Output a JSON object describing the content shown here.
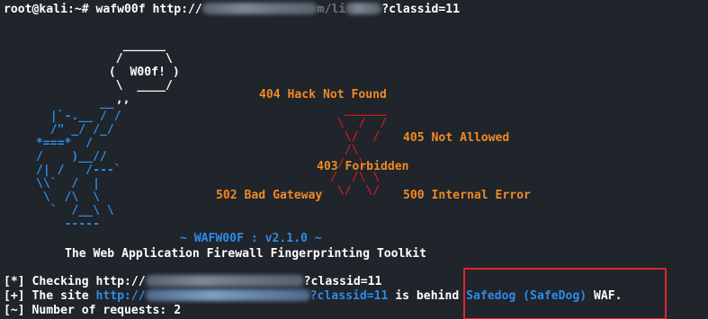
{
  "terminal": {
    "prompt": "root@kali:~# ",
    "command_start": "wafw00f http://",
    "command_end": "?classid=11"
  },
  "dog_art": {
    "hex_lines": [
      "   ______",
      "  /      \\",
      " (  W00f! )",
      "  \\  ____/",
      "  ,,"
    ],
    "dog_lines": [
      "         __",
      "  |`-.__ / /",
      "  /\" _/ /_/",
      "*===*  /",
      "/    )__//",
      "/| /   /---`",
      "\\\\`  /  |",
      " \\  /\\  \\",
      "  `  /__\\ \\",
      "    -----"
    ]
  },
  "x_art": {
    "lines": [
      "  ______",
      " \\  /  /",
      "  \\/  /",
      "  /\\",
      " /  \\",
      "/  /\\ \\",
      " \\/  \\/"
    ]
  },
  "errors": {
    "e404": "404 Hack Not Found",
    "e405": "405 Not Allowed",
    "e403": "403 Forbidden",
    "e502": "502 Bad Gateway",
    "e500": "500 Internal Error"
  },
  "banner": {
    "version": "~ WAFW00F : v2.1.0 ~",
    "subtitle": "The Web Application Firewall Fingerprinting Toolkit"
  },
  "output": {
    "checking_prefix": "[*] Checking http://",
    "checking_suffix": "?classid=11",
    "site_prefix": "[+] The site ",
    "site_url_start": "http://",
    "site_url_end": "?classid=11",
    "behind_text": " is behind ",
    "waf_name": "Safedog (SafeDog)",
    "waf_suffix": " WAF.",
    "requests": "[~] Number of requests: 2"
  },
  "colors": {
    "background": "#20242b",
    "text": "#ffffff",
    "accent_blue": "#2d8ce6",
    "error_orange": "#ee8a25",
    "x_red": "#c41d1d",
    "highlight_box": "#e0252a"
  }
}
